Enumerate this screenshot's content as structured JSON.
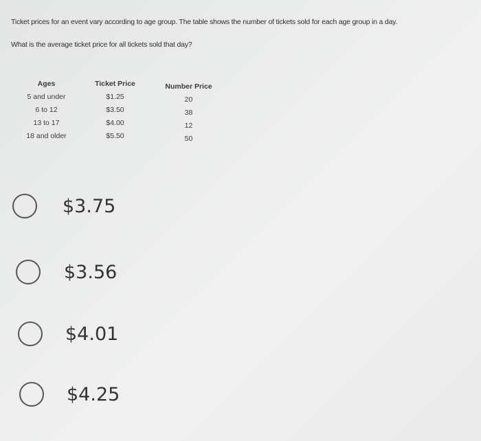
{
  "question": {
    "line1": "Ticket prices for an event vary according to age group. The table shows the number of tickets sold for each age group in a day.",
    "line2": "What is the average ticket price for all tickets sold that day?"
  },
  "table": {
    "headers": [
      "Ages",
      "Ticket Price",
      "Number Price"
    ],
    "rows": [
      {
        "age": "5 and under",
        "price": "$1.25",
        "number": "20"
      },
      {
        "age": "6 to 12",
        "price": "$3.50",
        "number": "38"
      },
      {
        "age": "13 to 17",
        "price": "$4.00",
        "number": "12"
      },
      {
        "age": "18 and older",
        "price": "$5.50",
        "number": "50"
      }
    ]
  },
  "options": [
    {
      "label": "$3.75",
      "selected": false
    },
    {
      "label": "$3.56",
      "selected": false
    },
    {
      "label": "$4.01",
      "selected": false
    },
    {
      "label": "$4.25",
      "selected": false
    }
  ]
}
